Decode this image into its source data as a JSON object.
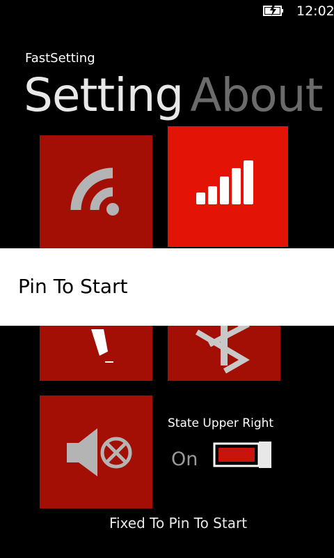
{
  "status_bar": {
    "time": "12:02",
    "battery_icon": "battery-charging-icon"
  },
  "app": {
    "name": "FastSetting"
  },
  "pivot": {
    "items": [
      {
        "label": "Setting",
        "active": true
      },
      {
        "label": "About",
        "active": false
      }
    ]
  },
  "tiles": [
    {
      "name": "wifi",
      "icon": "wifi-icon"
    },
    {
      "name": "cellular",
      "icon": "cellular-signal-icon"
    },
    {
      "name": "airplane",
      "icon": "airplane-icon"
    },
    {
      "name": "bluetooth",
      "icon": "bluetooth-icon"
    },
    {
      "name": "sound",
      "icon": "speaker-muted-icon"
    }
  ],
  "context_menu": {
    "items": [
      "Pin To Start"
    ]
  },
  "state_setting": {
    "label": "State Upper Right",
    "value": "On"
  },
  "footer": {
    "text": "Fixed To Pin To Start"
  },
  "colors": {
    "tile_dark": "#a30e05",
    "tile_bright": "#e31405",
    "background": "#000000",
    "menu_bg": "#ffffff"
  }
}
